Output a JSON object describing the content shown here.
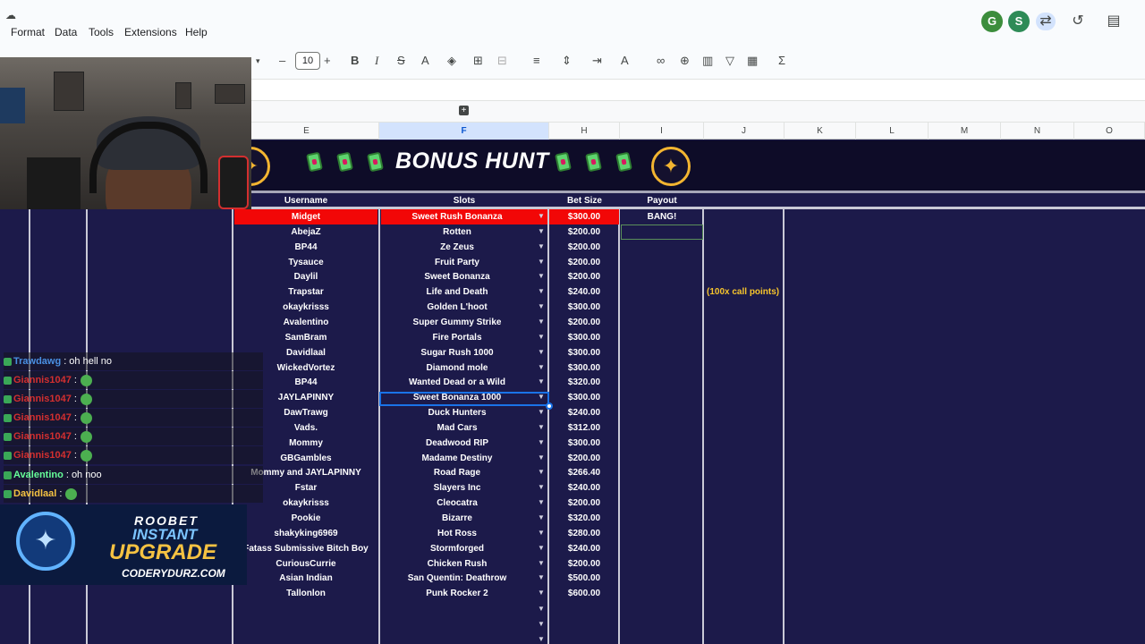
{
  "menu": {
    "items": [
      "Format",
      "Data",
      "Tools",
      "Extensions",
      "Help"
    ]
  },
  "header_right": {
    "avatars": [
      {
        "letter": "G",
        "color": "#3c8d3c"
      },
      {
        "letter": "S",
        "color": "#2e8b57"
      }
    ]
  },
  "toolbar": {
    "font_size": "10",
    "minus": "–",
    "plus": "+",
    "bold": "B",
    "italic": "I",
    "strike": "S",
    "text_color": "A",
    "sum": "Σ"
  },
  "columns": [
    "E",
    "F",
    "H",
    "I",
    "J",
    "K",
    "L",
    "M",
    "N",
    "O"
  ],
  "selected_column": "F",
  "banner": {
    "title": "BONUS HUNT"
  },
  "table": {
    "headers": {
      "username": "Username",
      "slots": "Slots",
      "bet_size": "Bet Size",
      "payout": "Payout"
    },
    "rows": [
      {
        "username": "Midget",
        "slot": "Sweet Rush Bonanza",
        "bet": "$300.00",
        "payout": "BANG!"
      },
      {
        "username": "AbejaZ",
        "slot": "Rotten",
        "bet": "$200.00",
        "payout": ""
      },
      {
        "username": "BP44",
        "slot": "Ze Zeus",
        "bet": "$200.00",
        "payout": ""
      },
      {
        "username": "Tysauce",
        "slot": "Fruit Party",
        "bet": "$200.00",
        "payout": ""
      },
      {
        "username": "Daylil",
        "slot": "Sweet Bonanza",
        "bet": "$200.00",
        "payout": ""
      },
      {
        "username": "Trapstar",
        "slot": "Life and Death",
        "bet": "$240.00",
        "payout": ""
      },
      {
        "username": "okaykrisss",
        "slot": "Golden L'hoot",
        "bet": "$300.00",
        "payout": ""
      },
      {
        "username": "Avalentino",
        "slot": "Super Gummy Strike",
        "bet": "$200.00",
        "payout": ""
      },
      {
        "username": "SamBram",
        "slot": "Fire Portals",
        "bet": "$300.00",
        "payout": ""
      },
      {
        "username": "Davidlaal",
        "slot": "Sugar Rush 1000",
        "bet": "$300.00",
        "payout": ""
      },
      {
        "username": "WickedVortez",
        "slot": "Diamond mole",
        "bet": "$300.00",
        "payout": ""
      },
      {
        "username": "BP44",
        "slot": "Wanted Dead or a Wild",
        "bet": "$320.00",
        "payout": ""
      },
      {
        "username": "JAYLAPINNY",
        "slot": "Sweet Bonanza 1000",
        "bet": "$300.00",
        "payout": ""
      },
      {
        "username": "DawTrawg",
        "slot": "Duck Hunters",
        "bet": "$240.00",
        "payout": ""
      },
      {
        "username": "Vads.",
        "slot": "Mad Cars",
        "bet": "$312.00",
        "payout": ""
      },
      {
        "username": "Mommy",
        "slot": "Deadwood RIP",
        "bet": "$300.00",
        "payout": ""
      },
      {
        "username": "GBGambles",
        "slot": "Madame Destiny",
        "bet": "$200.00",
        "payout": ""
      },
      {
        "username": "Mommy and JAYLAPINNY",
        "slot": "Road Rage",
        "bet": "$266.40",
        "payout": ""
      },
      {
        "username": "Fstar",
        "slot": "Slayers Inc",
        "bet": "$240.00",
        "payout": ""
      },
      {
        "username": "okaykrisss",
        "slot": "Cleocatra",
        "bet": "$200.00",
        "payout": ""
      },
      {
        "username": "Pookie",
        "slot": "Bizarre",
        "bet": "$320.00",
        "payout": ""
      },
      {
        "username": "shakyking6969",
        "slot": "Hot Ross",
        "bet": "$280.00",
        "payout": ""
      },
      {
        "username": "Fatass Submissive Bitch Boy",
        "slot": "Stormforged",
        "bet": "$240.00",
        "payout": ""
      },
      {
        "username": "CuriousCurrie",
        "slot": "Chicken Rush",
        "bet": "$200.00",
        "payout": ""
      },
      {
        "username": "Asian Indian",
        "slot": "San Quentin: Deathrow",
        "bet": "$500.00",
        "payout": ""
      },
      {
        "username": "Tallonlon",
        "slot": "Punk Rocker 2",
        "bet": "$600.00",
        "payout": ""
      }
    ],
    "note": "(100x call points)"
  },
  "chat": [
    {
      "user": "Trawdawg",
      "msg": ": oh hell no",
      "color": "#4a90e2"
    },
    {
      "user": "Giannis1047",
      "msg": ":",
      "color": "#d32f2f"
    },
    {
      "user": "Giannis1047",
      "msg": ":",
      "color": "#d32f2f"
    },
    {
      "user": "Giannis1047",
      "msg": ":",
      "color": "#d32f2f"
    },
    {
      "user": "Giannis1047",
      "msg": ":",
      "color": "#d32f2f"
    },
    {
      "user": "Giannis1047",
      "msg": ":",
      "color": "#d32f2f"
    },
    {
      "user": "Avalentino",
      "msg": ": oh noo",
      "color": "#66ff99"
    },
    {
      "user": "Davidlaal",
      "msg": ":",
      "color": "#f5c242"
    }
  ],
  "promo": {
    "line1": "ROOBET",
    "line2": "INSTANT",
    "line3": "UPGRADE",
    "line4": "CODERYDURZ.COM"
  }
}
